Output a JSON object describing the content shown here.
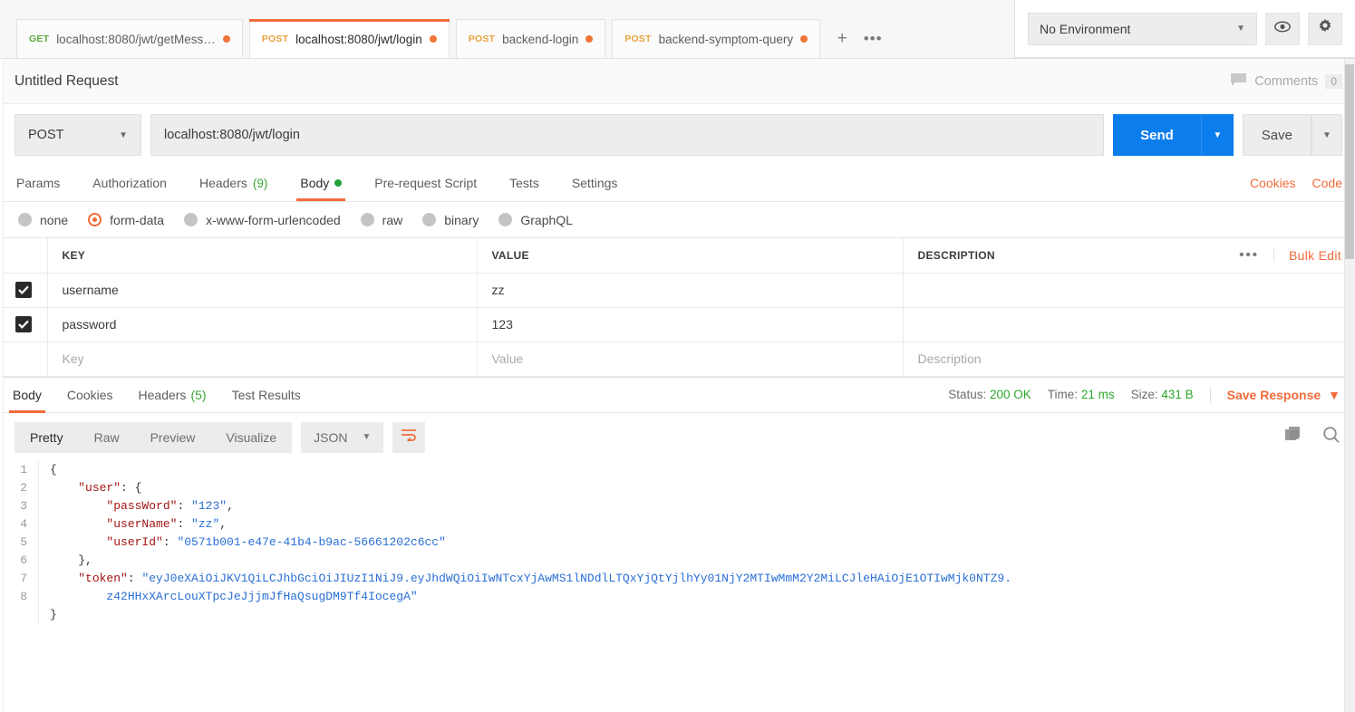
{
  "tabs": [
    {
      "method": "GET",
      "method_class": "m-get",
      "label": "localhost:8080/jwt/getMess…",
      "unsaved": true,
      "active": false
    },
    {
      "method": "POST",
      "method_class": "m-post",
      "label": "localhost:8080/jwt/login",
      "unsaved": true,
      "active": true
    },
    {
      "method": "POST",
      "method_class": "m-post",
      "label": "backend-login",
      "unsaved": true,
      "active": false
    },
    {
      "method": "POST",
      "method_class": "m-post",
      "label": "backend-symptom-query",
      "unsaved": true,
      "active": false
    }
  ],
  "tabbar": {
    "new_tab": "+",
    "more": "•••"
  },
  "environment": {
    "selected": "No Environment",
    "caret": "▼",
    "eye_icon": "eye-icon",
    "gear_icon": "gear-icon"
  },
  "request": {
    "title": "Untitled Request",
    "comments_label": "Comments",
    "comments_count": "0",
    "method": "POST",
    "url": "localhost:8080/jwt/login",
    "send_label": "Send",
    "save_label": "Save",
    "caret": "▼"
  },
  "request_tabs": [
    {
      "label": "Params",
      "active": false
    },
    {
      "label": "Authorization",
      "active": false
    },
    {
      "label": "Headers",
      "count": "(9)",
      "active": false
    },
    {
      "label": "Body",
      "active": true,
      "dot": true
    },
    {
      "label": "Pre-request Script",
      "active": false
    },
    {
      "label": "Tests",
      "active": false
    },
    {
      "label": "Settings",
      "active": false
    }
  ],
  "request_links": [
    "Cookies",
    "Code"
  ],
  "body_types": [
    {
      "label": "none",
      "selected": false
    },
    {
      "label": "form-data",
      "selected": true
    },
    {
      "label": "x-www-form-urlencoded",
      "selected": false
    },
    {
      "label": "raw",
      "selected": false
    },
    {
      "label": "binary",
      "selected": false
    },
    {
      "label": "GraphQL",
      "selected": false
    }
  ],
  "form_table": {
    "headers": {
      "key": "KEY",
      "value": "VALUE",
      "description": "DESCRIPTION"
    },
    "bulk_edit": "Bulk Edit",
    "more_dots": "•••",
    "rows": [
      {
        "checked": true,
        "key": "username",
        "value": "zz",
        "description": ""
      },
      {
        "checked": true,
        "key": "password",
        "value": "123",
        "description": ""
      }
    ],
    "placeholder_row": {
      "key": "Key",
      "value": "Value",
      "description": "Description"
    }
  },
  "response_tabs": [
    {
      "label": "Body",
      "active": true
    },
    {
      "label": "Cookies",
      "active": false
    },
    {
      "label": "Headers",
      "count": "(5)",
      "active": false
    },
    {
      "label": "Test Results",
      "active": false
    }
  ],
  "response_meta": {
    "status_label": "Status:",
    "status_value": "200 OK",
    "time_label": "Time:",
    "time_value": "21 ms",
    "size_label": "Size:",
    "size_value": "431 B",
    "save_response": "Save Response",
    "caret": "▼"
  },
  "response_view": {
    "segments": [
      {
        "label": "Pretty",
        "active": true
      },
      {
        "label": "Raw",
        "active": false
      },
      {
        "label": "Preview",
        "active": false
      },
      {
        "label": "Visualize",
        "active": false
      }
    ],
    "format": "JSON",
    "caret": "▼",
    "wrap_icon": "word-wrap-icon",
    "copy_icon": "copy-icon",
    "search_icon": "search-icon"
  },
  "response_body": {
    "line_numbers": [
      "1",
      "2",
      "3",
      "4",
      "5",
      "6",
      "7",
      "8"
    ],
    "lines": [
      [
        {
          "t": "{",
          "c": "c-brace"
        }
      ],
      [
        {
          "t": "    ",
          "c": "c-punc"
        },
        {
          "t": "\"user\"",
          "c": "c-key"
        },
        {
          "t": ": {",
          "c": "c-punc"
        }
      ],
      [
        {
          "t": "        ",
          "c": "c-punc"
        },
        {
          "t": "\"passWord\"",
          "c": "c-key"
        },
        {
          "t": ": ",
          "c": "c-punc"
        },
        {
          "t": "\"123\"",
          "c": "c-str"
        },
        {
          "t": ",",
          "c": "c-punc"
        }
      ],
      [
        {
          "t": "        ",
          "c": "c-punc"
        },
        {
          "t": "\"userName\"",
          "c": "c-key"
        },
        {
          "t": ": ",
          "c": "c-punc"
        },
        {
          "t": "\"zz\"",
          "c": "c-str"
        },
        {
          "t": ",",
          "c": "c-punc"
        }
      ],
      [
        {
          "t": "        ",
          "c": "c-punc"
        },
        {
          "t": "\"userId\"",
          "c": "c-key"
        },
        {
          "t": ": ",
          "c": "c-punc"
        },
        {
          "t": "\"0571b001-e47e-41b4-b9ac-56661202c6cc\"",
          "c": "c-str"
        }
      ],
      [
        {
          "t": "    },",
          "c": "c-punc"
        }
      ],
      [
        {
          "t": "    ",
          "c": "c-punc"
        },
        {
          "t": "\"token\"",
          "c": "c-key"
        },
        {
          "t": ": ",
          "c": "c-punc"
        },
        {
          "t": "\"eyJ0eXAiOiJKV1QiLCJhbGciOiJIUzI1NiJ9.eyJhdWQiOiIwNTcxYjAwMS1lNDdlLTQxYjQtYjlhYy01NjY2MTIwMmM2Y2MiLCJleHAiOjE1OTIwMjk0NTZ9.",
          "c": "c-str"
        }
      ],
      [
        {
          "t": "        ",
          "c": "c-punc"
        },
        {
          "t": "z42HHxXArcLouXTpcJeJjjmJfHaQsugDM9Tf4IocegA\"",
          "c": "c-str"
        }
      ],
      [
        {
          "t": "}",
          "c": "c-brace"
        }
      ]
    ]
  },
  "colors": {
    "accent_orange": "#f26b3a",
    "send_blue": "#0c7ded",
    "status_green": "#2aa82a",
    "method_get": "#5aaa3b",
    "method_post": "#e8a33d"
  }
}
